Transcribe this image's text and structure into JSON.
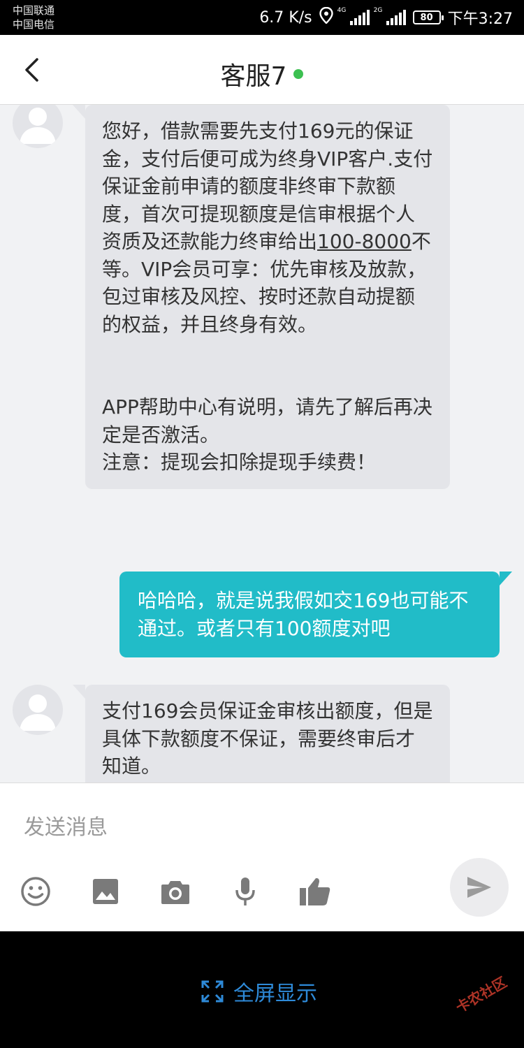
{
  "status_bar": {
    "carrier1": "中国联通",
    "carrier2": "中国电信",
    "speed": "6.7 K/s",
    "signal1_label": "4G",
    "signal2_label": "2G",
    "battery": "80",
    "time": "下午3:27"
  },
  "header": {
    "title": "客服7",
    "online_color": "#3cc051"
  },
  "messages": [
    {
      "side": "left",
      "p1a": "您好，借款需要先支付169元的保证金，支付后便可成为终身VIP客户.支付保证金前申请的额度非终审下款额度，首次可提现额度是信审根据个人资质及还款能力终审给出",
      "p1_underline": "100-8000",
      "p1b": "不等。VIP会员可享：优先审核及放款，包过审核及风控、按时还款自动提额的权益，并且终身有效。",
      "p2": "APP帮助中心有说明，请先了解后再决定是否激活。",
      "p3": "注意：提现会扣除提现手续费！"
    },
    {
      "side": "right",
      "text": "哈哈哈，就是说我假如交169也可能不通过。或者只有100额度对吧"
    },
    {
      "side": "left",
      "text": "支付169会员保证金审核出额度，但是具体下款额度不保证，需要终审后才知道。"
    }
  ],
  "input": {
    "placeholder": "发送消息"
  },
  "bottom": {
    "fullscreen_label": "全屏显示",
    "watermark": "卡农社区"
  },
  "colors": {
    "accent": "#21bcc8",
    "link": "#2e8ad8"
  }
}
